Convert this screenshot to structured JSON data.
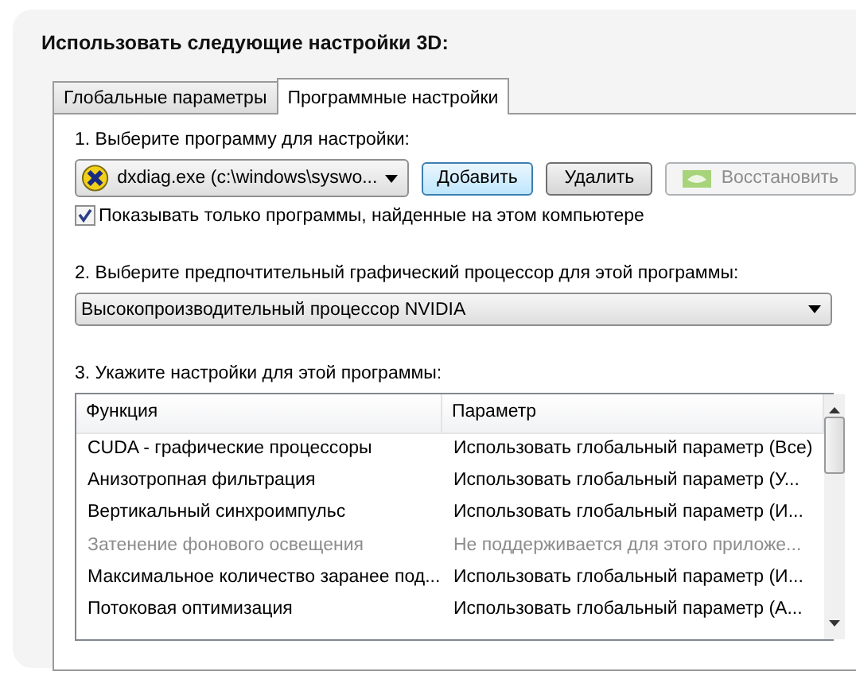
{
  "heading": "Использовать следующие настройки 3D:",
  "tabs": [
    {
      "label": "Глобальные параметры",
      "selected": false
    },
    {
      "label": "Программные настройки",
      "selected": true
    }
  ],
  "step1": {
    "label": "1. Выберите программу для настройки:",
    "program": "dxdiag.exe (c:\\windows\\syswo...",
    "buttons": [
      {
        "label": "Добавить",
        "kind": "default",
        "disabled": false
      },
      {
        "label": "Удалить",
        "kind": "normal",
        "disabled": false
      },
      {
        "label": "Восстановить",
        "kind": "logo",
        "disabled": true
      }
    ],
    "checkbox": {
      "label": "Показывать только программы, найденные на этом компьютере",
      "checked": true
    }
  },
  "step2": {
    "label": "2. Выберите предпочтительный графический процессор для этой программы:",
    "value": "Высокопроизводительный процессор NVIDIA"
  },
  "step3": {
    "label": "3. Укажите настройки для этой программы:",
    "table": {
      "columns": [
        "Функция",
        "Параметр"
      ],
      "rows": [
        {
          "cells": [
            "CUDA - графические процессоры",
            "Использовать глобальный параметр (Все)"
          ],
          "disabled": false
        },
        {
          "cells": [
            "Анизотропная фильтрация",
            "Использовать глобальный параметр (У..."
          ],
          "disabled": false
        },
        {
          "cells": [
            "Вертикальный синхроимпульс",
            "Использовать глобальный параметр (И..."
          ],
          "disabled": false
        },
        {
          "cells": [
            "Затенение фонового освещения",
            "Не поддерживается для этого приложе..."
          ],
          "disabled": true
        },
        {
          "cells": [
            "Максимальное количество заранее под...",
            "Использовать глобальный параметр (И..."
          ],
          "disabled": false
        },
        {
          "cells": [
            "Потоковая оптимизация",
            "Использовать глобальный параметр (А..."
          ],
          "disabled": false
        }
      ]
    }
  }
}
